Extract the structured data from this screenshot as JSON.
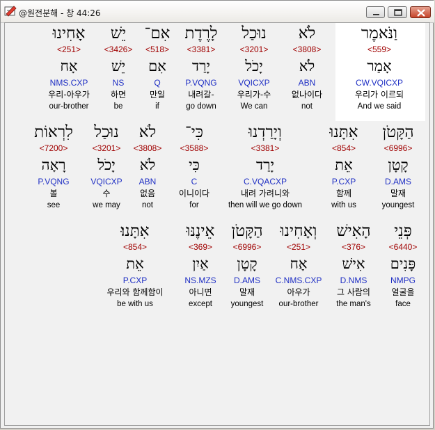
{
  "window": {
    "title": "@원전분해 - 창 44:26"
  },
  "rows": [
    {
      "words": [
        {
          "heb": "וַנֹּאמֶר",
          "num": "<559>",
          "lex": "אָמַר",
          "morph": "CW.VQICXP",
          "kor": "우리가 이르되",
          "eng": "And we said"
        },
        {
          "heb": "לֹא",
          "num": "<3808>",
          "lex": "לֹא",
          "morph": "ABN",
          "kor": "없나이다",
          "eng": "not"
        },
        {
          "heb": "נוּכַל",
          "num": "<3201>",
          "lex": "יָכֹל",
          "morph": "VQICXP",
          "kor": "우리가-수",
          "eng": "We can"
        },
        {
          "heb": "לָרֶדֶת",
          "num": "<3381>",
          "lex": "יָרַד",
          "morph": "P.VQNG",
          "kor": "내려갈-",
          "eng": "go down"
        },
        {
          "heb": "אִם־",
          "num": "<518>",
          "lex": "אִם",
          "morph": "Q",
          "kor": "만일",
          "eng": "if"
        },
        {
          "heb": "יֵשׁ",
          "num": "<3426>",
          "lex": "יֵשׁ",
          "morph": "NS",
          "kor": "하면",
          "eng": "be"
        },
        {
          "heb": "אָחִינוּ",
          "num": "<251>",
          "lex": "אָח",
          "morph": "NMS.CXP",
          "kor": "우리-아우가",
          "eng": "our-brother"
        }
      ]
    },
    {
      "words": [
        {
          "heb": "הַקָּטֹן",
          "num": "<6996>",
          "lex": "קָטָן",
          "morph": "D.AMS",
          "kor": "말재",
          "eng": "youngest"
        },
        {
          "heb": "אִתָּנוּ",
          "num": "<854>",
          "lex": "אֵת",
          "morph": "P.CXP",
          "kor": "함께",
          "eng": "with us"
        },
        {
          "heb": "וְיָרַדְנוּ",
          "num": "<3381>",
          "lex": "יָרַד",
          "morph": "C.VQACXP",
          "kor": "내려 가려니와",
          "eng": "then will we go down"
        },
        {
          "heb": "כִּי־",
          "num": "<3588>",
          "lex": "כִּי",
          "morph": "C",
          "kor": "이니이다",
          "eng": "for"
        },
        {
          "heb": "לֹא",
          "num": "<3808>",
          "lex": "לֹא",
          "morph": "ABN",
          "kor": "없음",
          "eng": "not"
        },
        {
          "heb": "נוּכַל",
          "num": "<3201>",
          "lex": "יָכֹל",
          "morph": "VQICXP",
          "kor": "수",
          "eng": "we may"
        },
        {
          "heb": "לִרְאוֹת",
          "num": "<7200>",
          "lex": "רָאָה",
          "morph": "P.VQNG",
          "kor": "볼",
          "eng": "see"
        }
      ]
    },
    {
      "words": [
        {
          "heb": "פְּנֵי",
          "num": "<6440>",
          "lex": "פָּנִים",
          "morph": "NMPG",
          "kor": "얼굴을",
          "eng": "face"
        },
        {
          "heb": "הָאִישׁ",
          "num": "<376>",
          "lex": "אִישׁ",
          "morph": "D.NMS",
          "kor": "그 사람의",
          "eng": "the man's"
        },
        {
          "heb": "וְאָחִינוּ",
          "num": "<251>",
          "lex": "אָח",
          "morph": "C.NMS.CXP",
          "kor": "아우가",
          "eng": "our-brother"
        },
        {
          "heb": "הַקָּטֹן",
          "num": "<6996>",
          "lex": "קָטָן",
          "morph": "D.AMS",
          "kor": "말재",
          "eng": "youngest"
        },
        {
          "heb": "אֵינֶנּוּ",
          "num": "<369>",
          "lex": "אַיִן",
          "morph": "NS.MZS",
          "kor": "아니면",
          "eng": "except"
        },
        {
          "heb": "אִתָּנוּ׃",
          "num": "<854>",
          "lex": "אֵת",
          "morph": "P.CXP",
          "kor": "우리와 함께함이",
          "eng": "be with us"
        }
      ]
    }
  ]
}
